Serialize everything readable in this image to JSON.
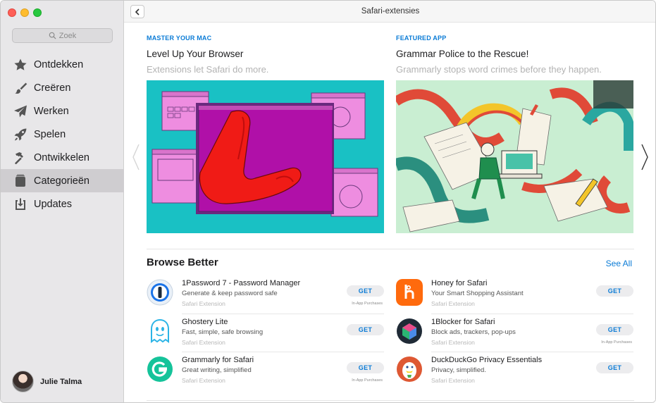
{
  "window": {
    "title": "Safari-extensies"
  },
  "sidebar": {
    "search_placeholder": "Zoek",
    "items": [
      {
        "label": "Ontdekken",
        "icon": "star-icon"
      },
      {
        "label": "Creëren",
        "icon": "paintbrush-icon"
      },
      {
        "label": "Werken",
        "icon": "paperplane-icon"
      },
      {
        "label": "Spelen",
        "icon": "rocket-icon"
      },
      {
        "label": "Ontwikkelen",
        "icon": "hammer-icon"
      },
      {
        "label": "Categorieën",
        "icon": "categories-icon",
        "active": true
      },
      {
        "label": "Updates",
        "icon": "updates-icon"
      }
    ],
    "user": {
      "name": "Julie Talma"
    }
  },
  "features": [
    {
      "kicker": "MASTER YOUR MAC",
      "headline": "Level Up Your Browser",
      "subtitle": "Extensions let Safari do more."
    },
    {
      "kicker": "FEATURED APP",
      "headline": "Grammar Police to the Rescue!",
      "subtitle": "Grammarly stops word crimes before they happen."
    }
  ],
  "browse": {
    "title": "Browse Better",
    "see_all": "See All",
    "get_label": "GET",
    "iap_label": "In-App Purchases",
    "left": [
      {
        "name": "1Password 7 - Password Manager",
        "desc": "Generate & keep password safe",
        "category": "Safari Extension",
        "iap": true
      },
      {
        "name": "Ghostery Lite",
        "desc": "Fast, simple, safe browsing",
        "category": "Safari Extension",
        "iap": false
      },
      {
        "name": "Grammarly for Safari",
        "desc": "Great writing, simplified",
        "category": "Safari Extension",
        "iap": true
      }
    ],
    "right": [
      {
        "name": "Honey for Safari",
        "desc": "Your Smart Shopping Assistant",
        "category": "Safari Extension",
        "iap": false
      },
      {
        "name": "1Blocker for Safari",
        "desc": "Block ads, trackers, pop-ups",
        "category": "Safari Extension",
        "iap": true
      },
      {
        "name": "DuckDuckGo Privacy Essentials",
        "desc": "Privacy, simplified.",
        "category": "Safari Extension",
        "iap": false
      }
    ]
  },
  "colors": {
    "accent": "#0a7bd6",
    "sidebar_bg": "#e8e7e9",
    "active_item": "#cfcdd0"
  }
}
